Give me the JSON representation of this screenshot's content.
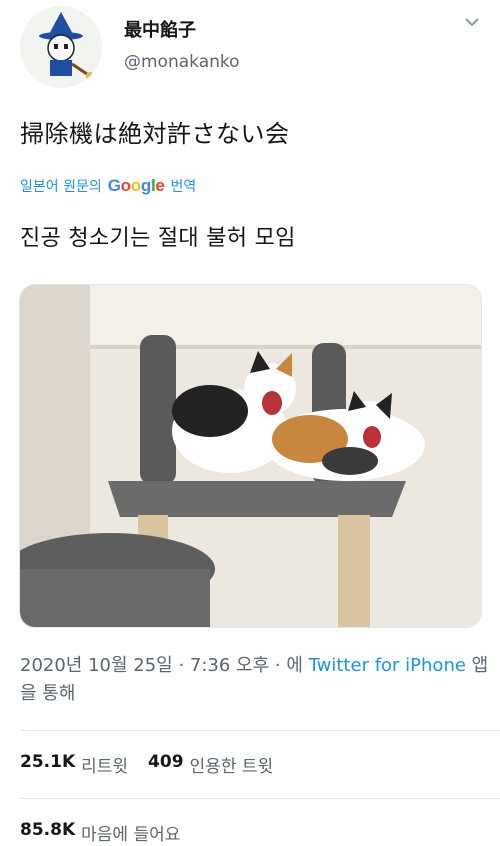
{
  "user": {
    "name": "最中餡子",
    "handle": "@monakanko"
  },
  "tweet": {
    "text": "掃除機は絶対許さない会",
    "translate_prefix": "일본어 원문의",
    "google_letters": [
      "G",
      "o",
      "o",
      "g",
      "l",
      "e"
    ],
    "translate_suffix": "번역",
    "translated_text": "진공 청소기는 절대 불허 모임"
  },
  "meta": {
    "timestamp": "2020년 10월 25일 · 7:36 오후 · 에",
    "source_link": "Twitter for iPhone",
    "source_suffix": "앱을 통해"
  },
  "stats": {
    "retweets_count": "25.1K",
    "retweets_label": "리트윗",
    "quotes_count": "409",
    "quotes_label": "인용한 트윗",
    "likes_count": "85.8K",
    "likes_label": "마음에 들어요"
  },
  "colors": {
    "link": "#1b95e0",
    "secondary_text": "#5b6670",
    "primary_text": "#14171a"
  },
  "icons": {
    "avatar": "witch-cat-avatar",
    "menu": "chevron-down-icon"
  }
}
